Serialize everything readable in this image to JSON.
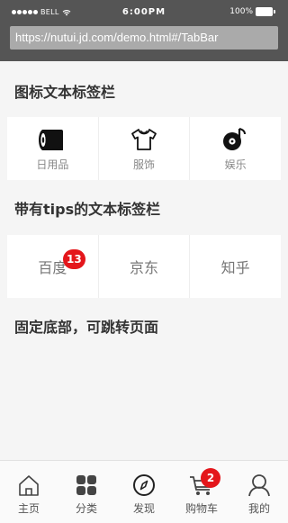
{
  "status_bar": {
    "carrier": "BELL",
    "time": "6:00PM",
    "battery": "100%"
  },
  "browser": {
    "url": "https://nutui.jd.com/demo.html#/TabBar"
  },
  "sections": {
    "icon_tabbar_title": "图标文本标签栏",
    "tips_tabbar_title": "带有tips的文本标签栏",
    "fixed_bottom_title": "固定底部，可跳转页面"
  },
  "icon_tabbar": {
    "items": [
      {
        "label": "日用品",
        "icon": "toilet-paper-icon"
      },
      {
        "label": "服饰",
        "icon": "tshirt-icon"
      },
      {
        "label": "娱乐",
        "icon": "music-disc-icon"
      }
    ]
  },
  "tips_tabbar": {
    "items": [
      {
        "label": "百度",
        "badge": "13"
      },
      {
        "label": "京东",
        "badge": ""
      },
      {
        "label": "知乎",
        "badge": ""
      }
    ]
  },
  "bottom_bar": {
    "items": [
      {
        "label": "主页",
        "icon": "home-icon",
        "badge": ""
      },
      {
        "label": "分类",
        "icon": "category-grid-icon",
        "badge": ""
      },
      {
        "label": "发现",
        "icon": "compass-icon",
        "badge": ""
      },
      {
        "label": "购物车",
        "icon": "shopping-cart-icon",
        "badge": "2"
      },
      {
        "label": "我的",
        "icon": "user-icon",
        "badge": ""
      }
    ]
  },
  "colors": {
    "badge": "#e4161b",
    "browser_chrome": "#555555",
    "url_bar": "#aaaaaa"
  }
}
